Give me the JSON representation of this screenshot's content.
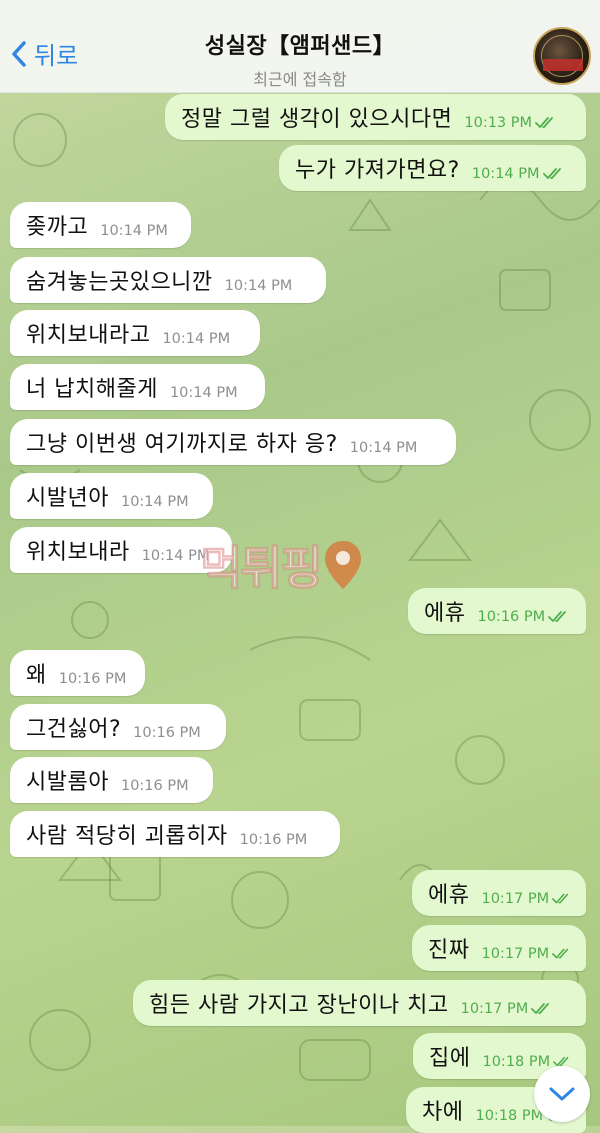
{
  "header": {
    "back_label": "뒤로",
    "title": "성실장【앰퍼샌드】",
    "status": "최근에 접속함"
  },
  "messages": [
    {
      "dir": "out",
      "text": "정말 그럴 생각이 있으시다면",
      "time": "10:13 PM"
    },
    {
      "dir": "out",
      "text": "누가 가져가면요?",
      "time": "10:14 PM"
    },
    {
      "dir": "in",
      "text": "좆까고",
      "time": "10:14 PM"
    },
    {
      "dir": "in",
      "text": "숨겨놓는곳있으니깐",
      "time": "10:14 PM"
    },
    {
      "dir": "in",
      "text": "위치보내라고",
      "time": "10:14 PM"
    },
    {
      "dir": "in",
      "text": "너 납치해줄게",
      "time": "10:14 PM"
    },
    {
      "dir": "in",
      "text": "그냥 이번생 여기까지로 하자 응?",
      "time": "10:14 PM"
    },
    {
      "dir": "in",
      "text": "시발년아",
      "time": "10:14 PM"
    },
    {
      "dir": "in",
      "text": "위치보내라",
      "time": "10:14 PM"
    },
    {
      "dir": "out",
      "text": "에휴",
      "time": "10:16 PM"
    },
    {
      "dir": "in",
      "text": "왜",
      "time": "10:16 PM"
    },
    {
      "dir": "in",
      "text": "그건싫어?",
      "time": "10:16 PM"
    },
    {
      "dir": "in",
      "text": "시발롬아",
      "time": "10:16 PM"
    },
    {
      "dir": "in",
      "text": "사람 적당히 괴롭히자",
      "time": "10:16 PM"
    },
    {
      "dir": "out",
      "text": "에휴",
      "time": "10:17 PM"
    },
    {
      "dir": "out",
      "text": "진짜",
      "time": "10:17 PM"
    },
    {
      "dir": "out",
      "text": "힘든 사람 가지고 장난이나 치고",
      "time": "10:17 PM"
    },
    {
      "dir": "out",
      "text": "집에",
      "time": "10:18 PM"
    },
    {
      "dir": "out",
      "text": "차에",
      "time": "10:18 PM"
    }
  ],
  "watermark_text": "먹튀핑",
  "icons": {
    "back": "chevron-left-icon",
    "read": "double-check-icon",
    "scroll": "chevron-down-icon",
    "pin": "map-pin-icon"
  },
  "colors": {
    "accent": "#2f86e5",
    "outgoing_bubble": "#e4f8cf",
    "incoming_bubble": "#ffffff",
    "read_check": "#4fae4e"
  }
}
